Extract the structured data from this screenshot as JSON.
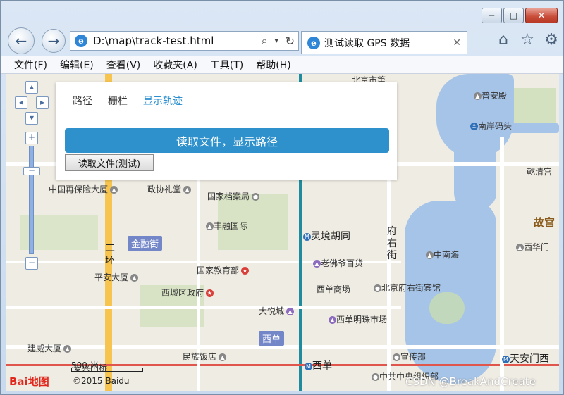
{
  "browser": {
    "address_url": "D:\\map\\track-test.html",
    "tab_title": "测试读取 GPS 数据",
    "caption_buttons": [
      "─",
      "□",
      "✕"
    ],
    "icons": [
      "back-icon",
      "forward-icon",
      "search-icon",
      "dropdown-icon",
      "refresh-icon",
      "close-icon",
      "home-icon",
      "favorites-icon",
      "settings-icon"
    ]
  },
  "menu": [
    "文件(F)",
    "编辑(E)",
    "查看(V)",
    "收藏夹(A)",
    "工具(T)",
    "帮助(H)"
  ],
  "panel": {
    "tabs": [
      "路径",
      "栅栏",
      "显示轨迹"
    ],
    "active_tab": "显示轨迹",
    "read_button": "读取文件，显示路径",
    "test_button": "读取文件(测试)"
  },
  "map": {
    "labels": {
      "zhongguo_zaibaoxian": "中国再保险大厦",
      "zhengxie_litang": "政协礼堂",
      "guojia_dangan": "国家档案局",
      "fengsheng_guoji": "丰融国际",
      "jinrongjie": "金融街",
      "lingjing_hutong": "灵境胡同",
      "guojia_jiaoyubu": "国家教育部",
      "laofoye_baihuo": "老佛爷百货",
      "pingan_dasha": "平安大厦",
      "xicheng_zhengfu": "西城区政府",
      "xidan_shangchang": "西单商场",
      "beijingfu_binguan": "北京府右街宾馆",
      "dayuecheng": "大悦城",
      "xidan_mingzhu": "西单明珠市场",
      "xidan_badge": "西单",
      "xidan_station": "西单",
      "jianwei_dasha": "建威大厦",
      "minzu_fandian": "民族饭店",
      "xuanchuanbu": "宣传部",
      "zhongnanhai": "中南海",
      "fuyoujie": "府\n右\n街",
      "huanxian": "二\n环",
      "nanan_matou": "南岸码头",
      "qianqinggong": "乾清宫",
      "gugong": "故宫",
      "xihuamen": "西华门",
      "tiananmen_west": "天安门西",
      "puanmian": "普安殿",
      "beijing_shida": "北京市第三",
      "fuxingmen_label": "复兴门桥",
      "zhonggong_zhongyang": "中共中央组织部"
    },
    "scale_label": "500 米",
    "logo": "Bai地图",
    "copyright": "©2015 Baidu",
    "watermark": "CSDN @BreakAndCreate"
  }
}
